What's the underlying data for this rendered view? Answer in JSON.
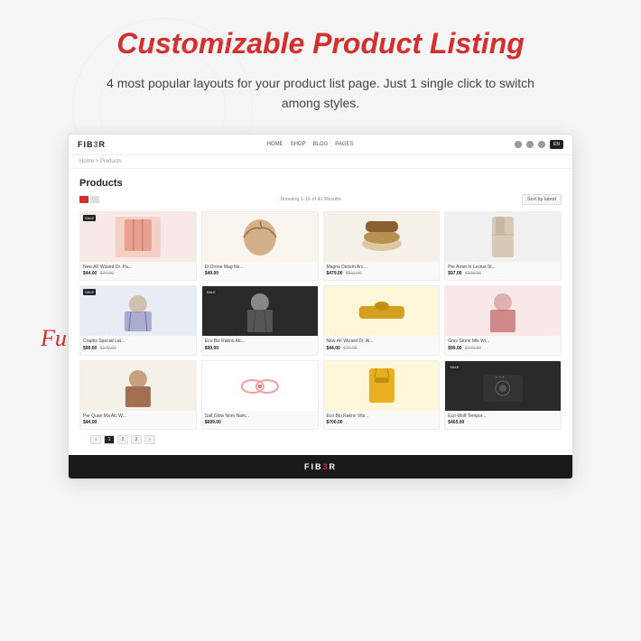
{
  "page": {
    "title": "Customizable Product Listing",
    "subtitle": "4 most popular layouts for your product list page. Just 1 single click to switch among styles.",
    "full_width_label": "Full Width"
  },
  "navbar": {
    "logo": "FIB3R",
    "links": [
      "HOME",
      "SHOP",
      "BLOG",
      "PAGES"
    ],
    "button": "ENGLISH"
  },
  "breadcrumb": "Home > Products",
  "products_section": {
    "title": "Products",
    "filter_text": "Showing 1-16 of 41 Results",
    "sort_label": "Sort by latest",
    "view_modes": [
      "grid",
      "list"
    ]
  },
  "products": [
    {
      "name": "New AF Wizard Dr. Pa...",
      "price": "$44.00",
      "old_price": "$77.00",
      "badge": "SALE",
      "bg": "pink"
    },
    {
      "name": "Et Drone Mag Ne...",
      "price": "$49.00",
      "old_price": "",
      "badge": "",
      "bg": "cream"
    },
    {
      "name": "Magna Dictum Arc...",
      "price": "$479.00",
      "old_price": "$511.00",
      "badge": "",
      "bg": "beige"
    },
    {
      "name": "Per Amet In Lectus St...",
      "price": "$97.00",
      "old_price": "$132.00",
      "badge": "",
      "bg": "light"
    },
    {
      "name": "Craptis Special Lat...",
      "price": "$99.00",
      "old_price": "$149.00",
      "badge": "SALE",
      "bg": "blue"
    },
    {
      "name": "Eco Biz Rakno Alc...",
      "price": "$99.00",
      "old_price": "",
      "badge": "SALE",
      "bg": "dark"
    },
    {
      "name": "New AF Wizard Dr. Al...",
      "price": "$44.00",
      "old_price": "$77.00",
      "badge": "",
      "bg": "yellow"
    },
    {
      "name": "Grav Stone Mik Wr...",
      "price": "$99.00",
      "old_price": "$149.00",
      "badge": "",
      "bg": "pink"
    },
    {
      "name": "Per Quan Ma Alc W...",
      "price": "$44.00",
      "old_price": "",
      "badge": "",
      "bg": "beige"
    },
    {
      "name": "Salt Glow Nom Nam...",
      "price": "$699.00",
      "old_price": "",
      "badge": "",
      "bg": "white"
    },
    {
      "name": "Eco Bio Rakno Vits...",
      "price": "$700.00",
      "old_price": "",
      "badge": "",
      "bg": "yellow"
    },
    {
      "name": "Eco-Wolf Tempor...",
      "price": "$465.00",
      "old_price": "",
      "badge": "SALE",
      "bg": "dark"
    }
  ],
  "pagination": {
    "current": "1",
    "pages": [
      "1",
      "2",
      "3"
    ]
  },
  "footer": {
    "logo": "FIB3R"
  }
}
